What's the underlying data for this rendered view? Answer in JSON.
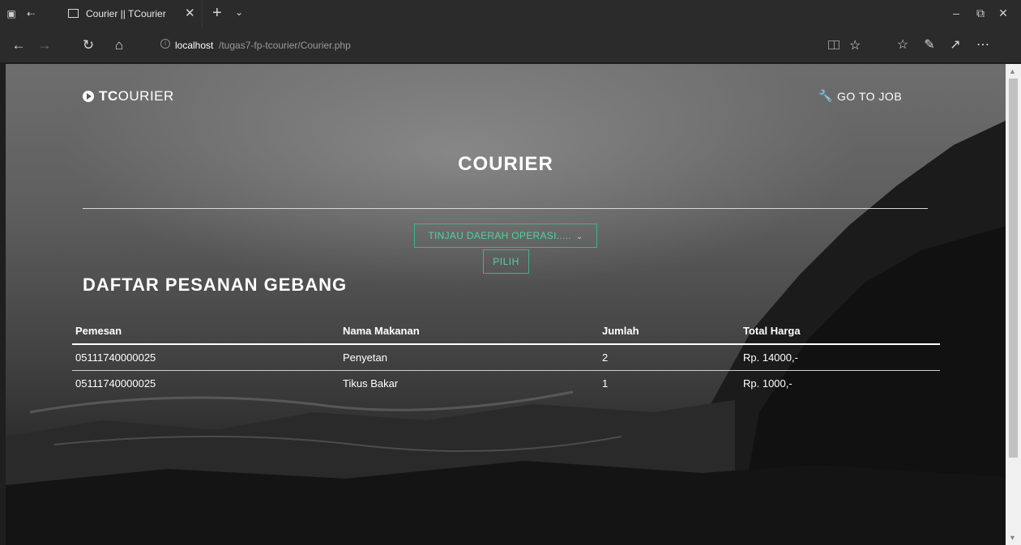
{
  "browser": {
    "tab_title": "Courier || TCourier",
    "url_host": "localhost",
    "url_path": "/tugas7-fp-tcourier/Courier.php"
  },
  "site": {
    "brand_bold": "TC",
    "brand_rest": "OURIER",
    "nav_link": "GO TO JOB",
    "page_title": "COURIER",
    "operation_select": "TINJAU DAERAH OPERASI.....",
    "choose_button": "PILIH",
    "section_title": "DAFTAR PESANAN GEBANG"
  },
  "table": {
    "headers": [
      "Pemesan",
      "Nama Makanan",
      "Jumlah",
      "Total Harga"
    ],
    "rows": [
      [
        "05111740000025",
        "Penyetan",
        "2",
        "Rp. 14000,-"
      ],
      [
        "05111740000025",
        "Tikus Bakar",
        "1",
        "Rp. 1000,-"
      ]
    ]
  },
  "colors": {
    "accent": "#4fd39d",
    "chrome": "#2b2b2b"
  }
}
